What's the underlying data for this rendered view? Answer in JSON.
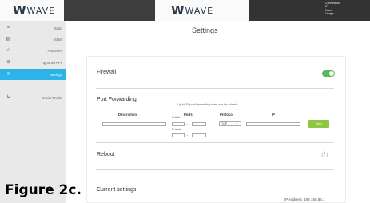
{
  "header": {
    "logo_text": "WAVE",
    "connection_info": [
      "Connection:",
      "IP:",
      "Used:",
      "Usage:"
    ]
  },
  "sidebar": {
    "items": [
      {
        "label": "Scan",
        "icon": "wifi-icon"
      },
      {
        "label": "Stats",
        "icon": "bar-chart-icon"
      },
      {
        "label": "Favorites",
        "icon": "star-icon"
      },
      {
        "label": "Ignored APs",
        "icon": "block-icon"
      },
      {
        "label": "Settings",
        "icon": "gear-icon",
        "active": true
      },
      {
        "label": "Social Media",
        "icon": "share-icon"
      }
    ]
  },
  "main": {
    "page_title": "Settings",
    "firewall": {
      "title": "Firewall",
      "enabled": true
    },
    "port_forwarding": {
      "title": "Port Forwarding",
      "note": "Up to 20 port forwarding rules can be added.",
      "columns": [
        "Description",
        "Ports",
        "Protocol",
        "IP"
      ],
      "public_label": "Public:",
      "private_label": "Private:",
      "protocol_value": "TCP",
      "add_label": "Add"
    },
    "reboot": {
      "title": "Reboot"
    },
    "current_settings": {
      "title": "Current settings:",
      "ip_label": "IP Address: 192.168.86.1"
    }
  },
  "caption": "Figure 2c."
}
